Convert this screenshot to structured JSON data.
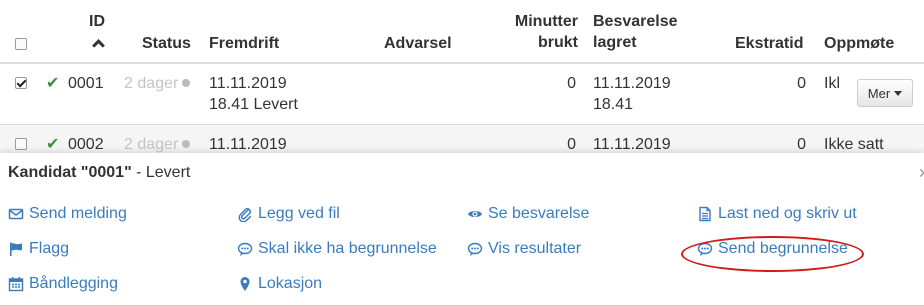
{
  "table": {
    "headers": {
      "id": "ID",
      "status": "Status",
      "fremdrift": "Fremdrift",
      "advarsel": "Advarsel",
      "minutter_line1": "Minutter",
      "minutter_line2": "brukt",
      "besvarelse_line1": "Besvarelse",
      "besvarelse_line2": "lagret",
      "ekstratid": "Ekstratid",
      "oppmote": "Oppmøte"
    },
    "rows": [
      {
        "checked": true,
        "id": "0001",
        "status": "2 dager",
        "fremdrift_date": "11.11.2019",
        "fremdrift_detail": "18.41 Levert",
        "advarsel": "",
        "minutter": "0",
        "besvarelse_date": "11.11.2019",
        "besvarelse_time": "18.41",
        "ekstratid": "0",
        "oppmote": "Ikl",
        "more_button": "Mer"
      },
      {
        "checked": false,
        "id": "0002",
        "status": "2 dager",
        "fremdrift_date": "11.11.2019",
        "advarsel": "",
        "minutter": "0",
        "besvarelse_date": "11.11.2019",
        "ekstratid": "0",
        "oppmote": "Ikke satt"
      }
    ]
  },
  "panel": {
    "title_bold": "Kandidat \"0001\"",
    "title_rest": " - Levert",
    "actions": {
      "send_melding": "Send melding",
      "flagg": "Flagg",
      "bandlegging": "Båndlegging",
      "legg_ved_fil": "Legg ved fil",
      "skal_ikke_begrunnelse": "Skal ikke ha begrunnelse",
      "lokasjon": "Lokasjon",
      "se_besvarelse": "Se besvarelse",
      "vis_resultater": "Vis resultater",
      "last_ned": "Last ned og skriv ut",
      "send_begrunnelse": "Send begrunnelse"
    }
  },
  "colors": {
    "link": "#3a7bbf",
    "check_green": "#3c8f3c",
    "highlight_red": "#d11a1a"
  }
}
